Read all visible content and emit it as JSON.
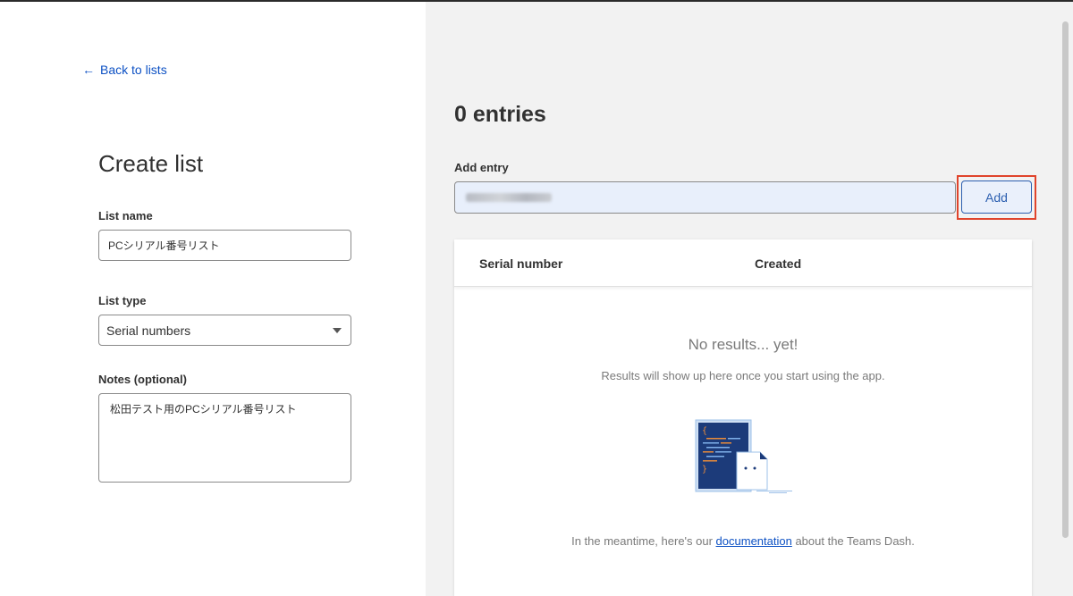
{
  "left_panel": {
    "back_link": "Back to lists",
    "page_title": "Create list",
    "list_name": {
      "label": "List name",
      "value": "PCシリアル番号リスト"
    },
    "list_type": {
      "label": "List type",
      "selected": "Serial numbers"
    },
    "notes": {
      "label": "Notes (optional)",
      "value": "松田テスト用のPCシリアル番号リスト"
    }
  },
  "right_panel": {
    "entries_title": "0 entries",
    "add_entry": {
      "label": "Add entry",
      "button_label": "Add"
    },
    "table": {
      "columns": [
        "Serial number",
        "Created"
      ],
      "empty_title": "No results... yet!",
      "empty_subtitle": "Results will show up here once you start using the app.",
      "doc_prefix": "In the meantime, here's our ",
      "doc_link": "documentation",
      "doc_suffix": " about the Teams Dash."
    }
  },
  "colors": {
    "link": "#0d51c4",
    "button_border": "#2c5fb0",
    "highlight": "#e0442c",
    "right_background": "#f2f2f2",
    "illustration_navy": "#1c3b7a",
    "illustration_orange": "#e98b3a"
  },
  "icons": {
    "back": "arrow-left-icon",
    "select": "caret-down-icon",
    "empty_state": "code-document-illustration"
  }
}
